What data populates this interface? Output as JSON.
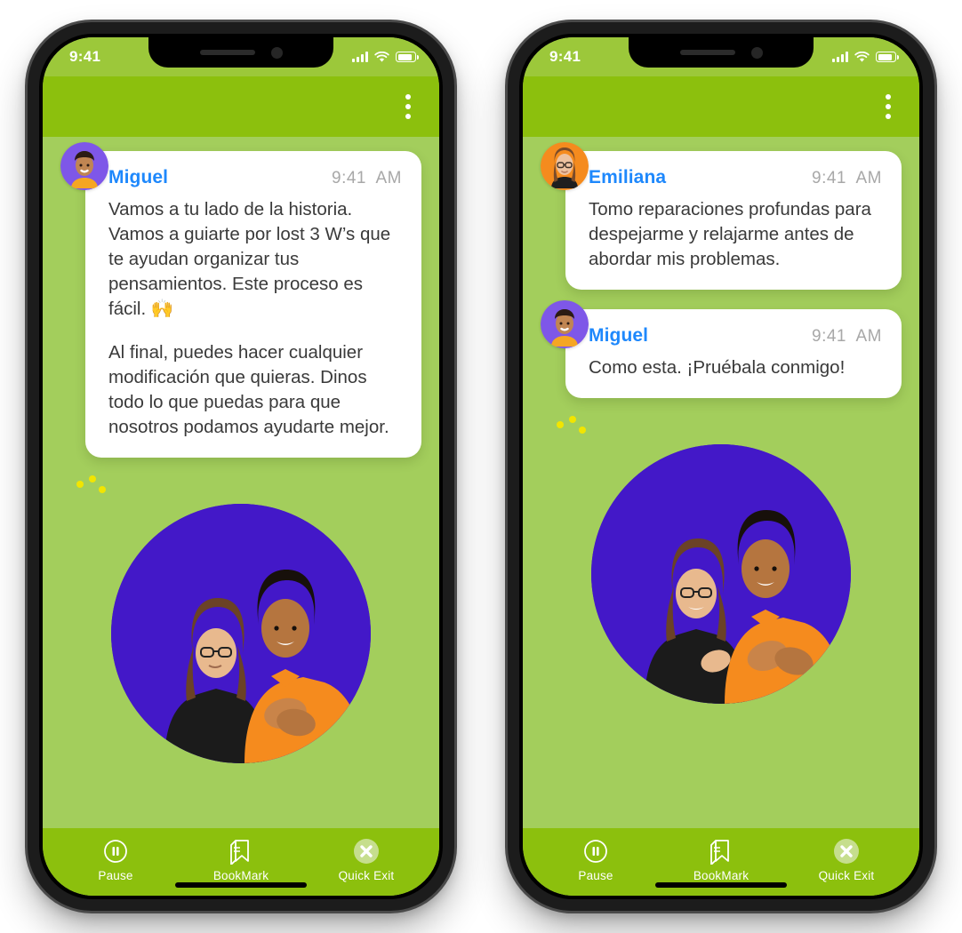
{
  "phones": [
    {
      "id": "phone-left",
      "status_bar": {
        "time": "9:41",
        "signal_icon": "cellular-signal-icon",
        "wifi_icon": "wifi-icon",
        "battery_icon": "battery-icon"
      },
      "app_bar": {
        "menu_icon": "kebab-menu-icon"
      },
      "messages": [
        {
          "sender": "Miguel",
          "time": "9:41  AM",
          "avatar": "avatar-miguel",
          "paragraphs": [
            "Vamos a tu lado de la historia. Vamos a guiarte por lost 3 W’s que te ayudan organizar tus pensamientos. Este proceso es fácil. 🙌",
            "Al final, puedes hacer cualquier modificación que quieras. Dinos todo lo que puedas para que nosotros podamos ayudarte mejor."
          ]
        }
      ],
      "typing_indicator": {
        "visible": true,
        "dot_color": "#F2E500"
      },
      "video": {
        "background": "#4318C8",
        "description": "asl-signers-video"
      },
      "toolbar": [
        {
          "label": "Pause",
          "icon": "pause-circle-icon"
        },
        {
          "label": "BookMark",
          "icon": "bookmark-ribbon-icon"
        },
        {
          "label": "Quick Exit",
          "icon": "close-circle-icon"
        }
      ]
    },
    {
      "id": "phone-right",
      "status_bar": {
        "time": "9:41",
        "signal_icon": "cellular-signal-icon",
        "wifi_icon": "wifi-icon",
        "battery_icon": "battery-icon"
      },
      "app_bar": {
        "menu_icon": "kebab-menu-icon"
      },
      "messages": [
        {
          "sender": "Emiliana",
          "time": "9:41  AM",
          "avatar": "avatar-emiliana",
          "paragraphs": [
            "Tomo reparaciones profundas para despejarme y relajarme antes de abordar mis problemas."
          ]
        },
        {
          "sender": "Miguel",
          "time": "9:41  AM",
          "avatar": "avatar-miguel",
          "paragraphs": [
            "Como esta. ¡Pruébala conmigo!"
          ]
        }
      ],
      "typing_indicator": {
        "visible": true,
        "dot_color": "#F2E500"
      },
      "video": {
        "background": "#4318C8",
        "description": "asl-signers-video"
      },
      "toolbar": [
        {
          "label": "Pause",
          "icon": "pause-circle-icon"
        },
        {
          "label": "BookMark",
          "icon": "bookmark-ribbon-icon"
        },
        {
          "label": "Quick Exit",
          "icon": "close-circle-icon"
        }
      ]
    }
  ],
  "theme": {
    "status_bar_green": "#9CC83A",
    "header_green": "#8CC00D",
    "body_green": "#A3CE5C",
    "bubble_white": "#FFFFFF",
    "sender_blue": "#1E88FC",
    "time_gray": "#A8A8A8",
    "text_gray": "#3A3A3A",
    "video_purple": "#4318C8",
    "dot_yellow": "#F2E500"
  }
}
